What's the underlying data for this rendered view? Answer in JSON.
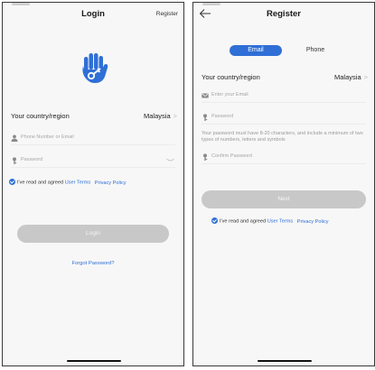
{
  "login": {
    "title": "Login",
    "register_link": "Register",
    "region_label": "Your country/region",
    "region_value": "Malaysia",
    "region_chevron": ">",
    "phone_placeholder": "Phone Number or Email",
    "password_placeholder": "Password",
    "agree_text": "I've read and agreed",
    "terms_link": "User Terms",
    "privacy_link": "Privacy Policy",
    "login_button": "Login",
    "forgot_link": "Forgot Password?"
  },
  "register": {
    "title": "Register",
    "tabs": {
      "email": "Email",
      "phone": "Phone"
    },
    "region_label": "Your country/region",
    "region_value": "Malaysia",
    "region_chevron": ">",
    "email_placeholder": "Enter your Email",
    "password_placeholder": "Password",
    "password_hint": "Your password must have 8-20 characters, and include a minimum of two types of numbers, letters and symbols",
    "confirm_placeholder": "Confirm Password",
    "next_button": "Next",
    "agree_text": "I've read and agreed",
    "terms_link": "User Terms",
    "privacy_link": "Privacy Policy"
  },
  "colors": {
    "accent": "#2f6fd6",
    "disabled_button": "#c8c8c8",
    "background": "#f7f7f7"
  },
  "icons": {
    "logo": "hand-key-logo",
    "user": "user-icon",
    "lock": "key-icon",
    "email": "envelope-icon",
    "eye": "eye-closed-icon",
    "back": "back-arrow-icon",
    "check": "checkmark-icon"
  }
}
